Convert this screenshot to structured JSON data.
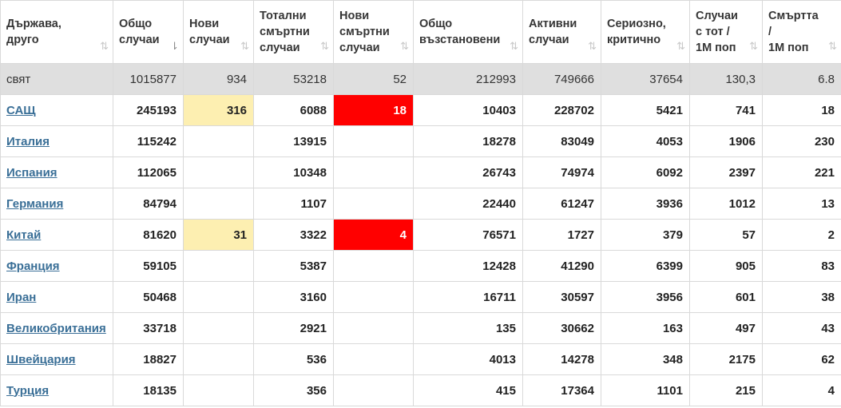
{
  "columns": [
    {
      "line1": "Държава,",
      "line2": "друго",
      "line3": "",
      "sort_active": false
    },
    {
      "line1": "Общо",
      "line2": "случаи",
      "line3": "",
      "sort_active": true
    },
    {
      "line1": "Нови",
      "line2": "случаи",
      "line3": "",
      "sort_active": false
    },
    {
      "line1": "Тотални",
      "line2": "смъртни",
      "line3": "случаи",
      "sort_active": false
    },
    {
      "line1": "Нови",
      "line2": "смъртни",
      "line3": "случаи",
      "sort_active": false
    },
    {
      "line1": "Общо",
      "line2": "възстановени",
      "line3": "",
      "sort_active": false
    },
    {
      "line1": "Активни",
      "line2": "случаи",
      "line3": "",
      "sort_active": false
    },
    {
      "line1": "Сериозно,",
      "line2": "критично",
      "line3": "",
      "sort_active": false
    },
    {
      "line1": "Случаи",
      "line2": "с тот /",
      "line3": "1М поп",
      "sort_active": false
    },
    {
      "line1": "Смъртта",
      "line2": "/",
      "line3": "1М поп",
      "sort_active": false
    }
  ],
  "sort_icons": {
    "inactive": "⇅",
    "active": "⇂"
  },
  "world": {
    "name": "свят",
    "total_cases": "1015877",
    "new_cases": "934",
    "total_deaths": "53218",
    "new_deaths": "52",
    "total_recovered": "212993",
    "active_cases": "749666",
    "serious_critical": "37654",
    "cases_per_1m": "130,3",
    "deaths_per_1m": "6.8"
  },
  "rows": [
    {
      "name": "САЩ",
      "total_cases": "245193",
      "new_cases": "316",
      "total_deaths": "6088",
      "new_deaths": "18",
      "total_recovered": "10403",
      "active_cases": "228702",
      "serious_critical": "5421",
      "cases_per_1m": "741",
      "deaths_per_1m": "18"
    },
    {
      "name": "Италия",
      "total_cases": "115242",
      "new_cases": "",
      "total_deaths": "13915",
      "new_deaths": "",
      "total_recovered": "18278",
      "active_cases": "83049",
      "serious_critical": "4053",
      "cases_per_1m": "1906",
      "deaths_per_1m": "230"
    },
    {
      "name": "Испания",
      "total_cases": "112065",
      "new_cases": "",
      "total_deaths": "10348",
      "new_deaths": "",
      "total_recovered": "26743",
      "active_cases": "74974",
      "serious_critical": "6092",
      "cases_per_1m": "2397",
      "deaths_per_1m": "221"
    },
    {
      "name": "Германия",
      "total_cases": "84794",
      "new_cases": "",
      "total_deaths": "1107",
      "new_deaths": "",
      "total_recovered": "22440",
      "active_cases": "61247",
      "serious_critical": "3936",
      "cases_per_1m": "1012",
      "deaths_per_1m": "13"
    },
    {
      "name": "Китай",
      "total_cases": "81620",
      "new_cases": "31",
      "total_deaths": "3322",
      "new_deaths": "4",
      "total_recovered": "76571",
      "active_cases": "1727",
      "serious_critical": "379",
      "cases_per_1m": "57",
      "deaths_per_1m": "2"
    },
    {
      "name": "Франция",
      "total_cases": "59105",
      "new_cases": "",
      "total_deaths": "5387",
      "new_deaths": "",
      "total_recovered": "12428",
      "active_cases": "41290",
      "serious_critical": "6399",
      "cases_per_1m": "905",
      "deaths_per_1m": "83"
    },
    {
      "name": "Иран",
      "total_cases": "50468",
      "new_cases": "",
      "total_deaths": "3160",
      "new_deaths": "",
      "total_recovered": "16711",
      "active_cases": "30597",
      "serious_critical": "3956",
      "cases_per_1m": "601",
      "deaths_per_1m": "38"
    },
    {
      "name": "Великобритания",
      "total_cases": "33718",
      "new_cases": "",
      "total_deaths": "2921",
      "new_deaths": "",
      "total_recovered": "135",
      "active_cases": "30662",
      "serious_critical": "163",
      "cases_per_1m": "497",
      "deaths_per_1m": "43"
    },
    {
      "name": "Швейцария",
      "total_cases": "18827",
      "new_cases": "",
      "total_deaths": "536",
      "new_deaths": "",
      "total_recovered": "4013",
      "active_cases": "14278",
      "serious_critical": "348",
      "cases_per_1m": "2175",
      "deaths_per_1m": "62"
    },
    {
      "name": "Турция",
      "total_cases": "18135",
      "new_cases": "",
      "total_deaths": "356",
      "new_deaths": "",
      "total_recovered": "415",
      "active_cases": "17364",
      "serious_critical": "1101",
      "cases_per_1m": "215",
      "deaths_per_1m": "4"
    }
  ],
  "colors": {
    "new_cases_highlight": "#fdefb1",
    "new_deaths_highlight": "#ff0000",
    "world_row_bg": "#dfdfdf",
    "link": "#3a6f97"
  }
}
